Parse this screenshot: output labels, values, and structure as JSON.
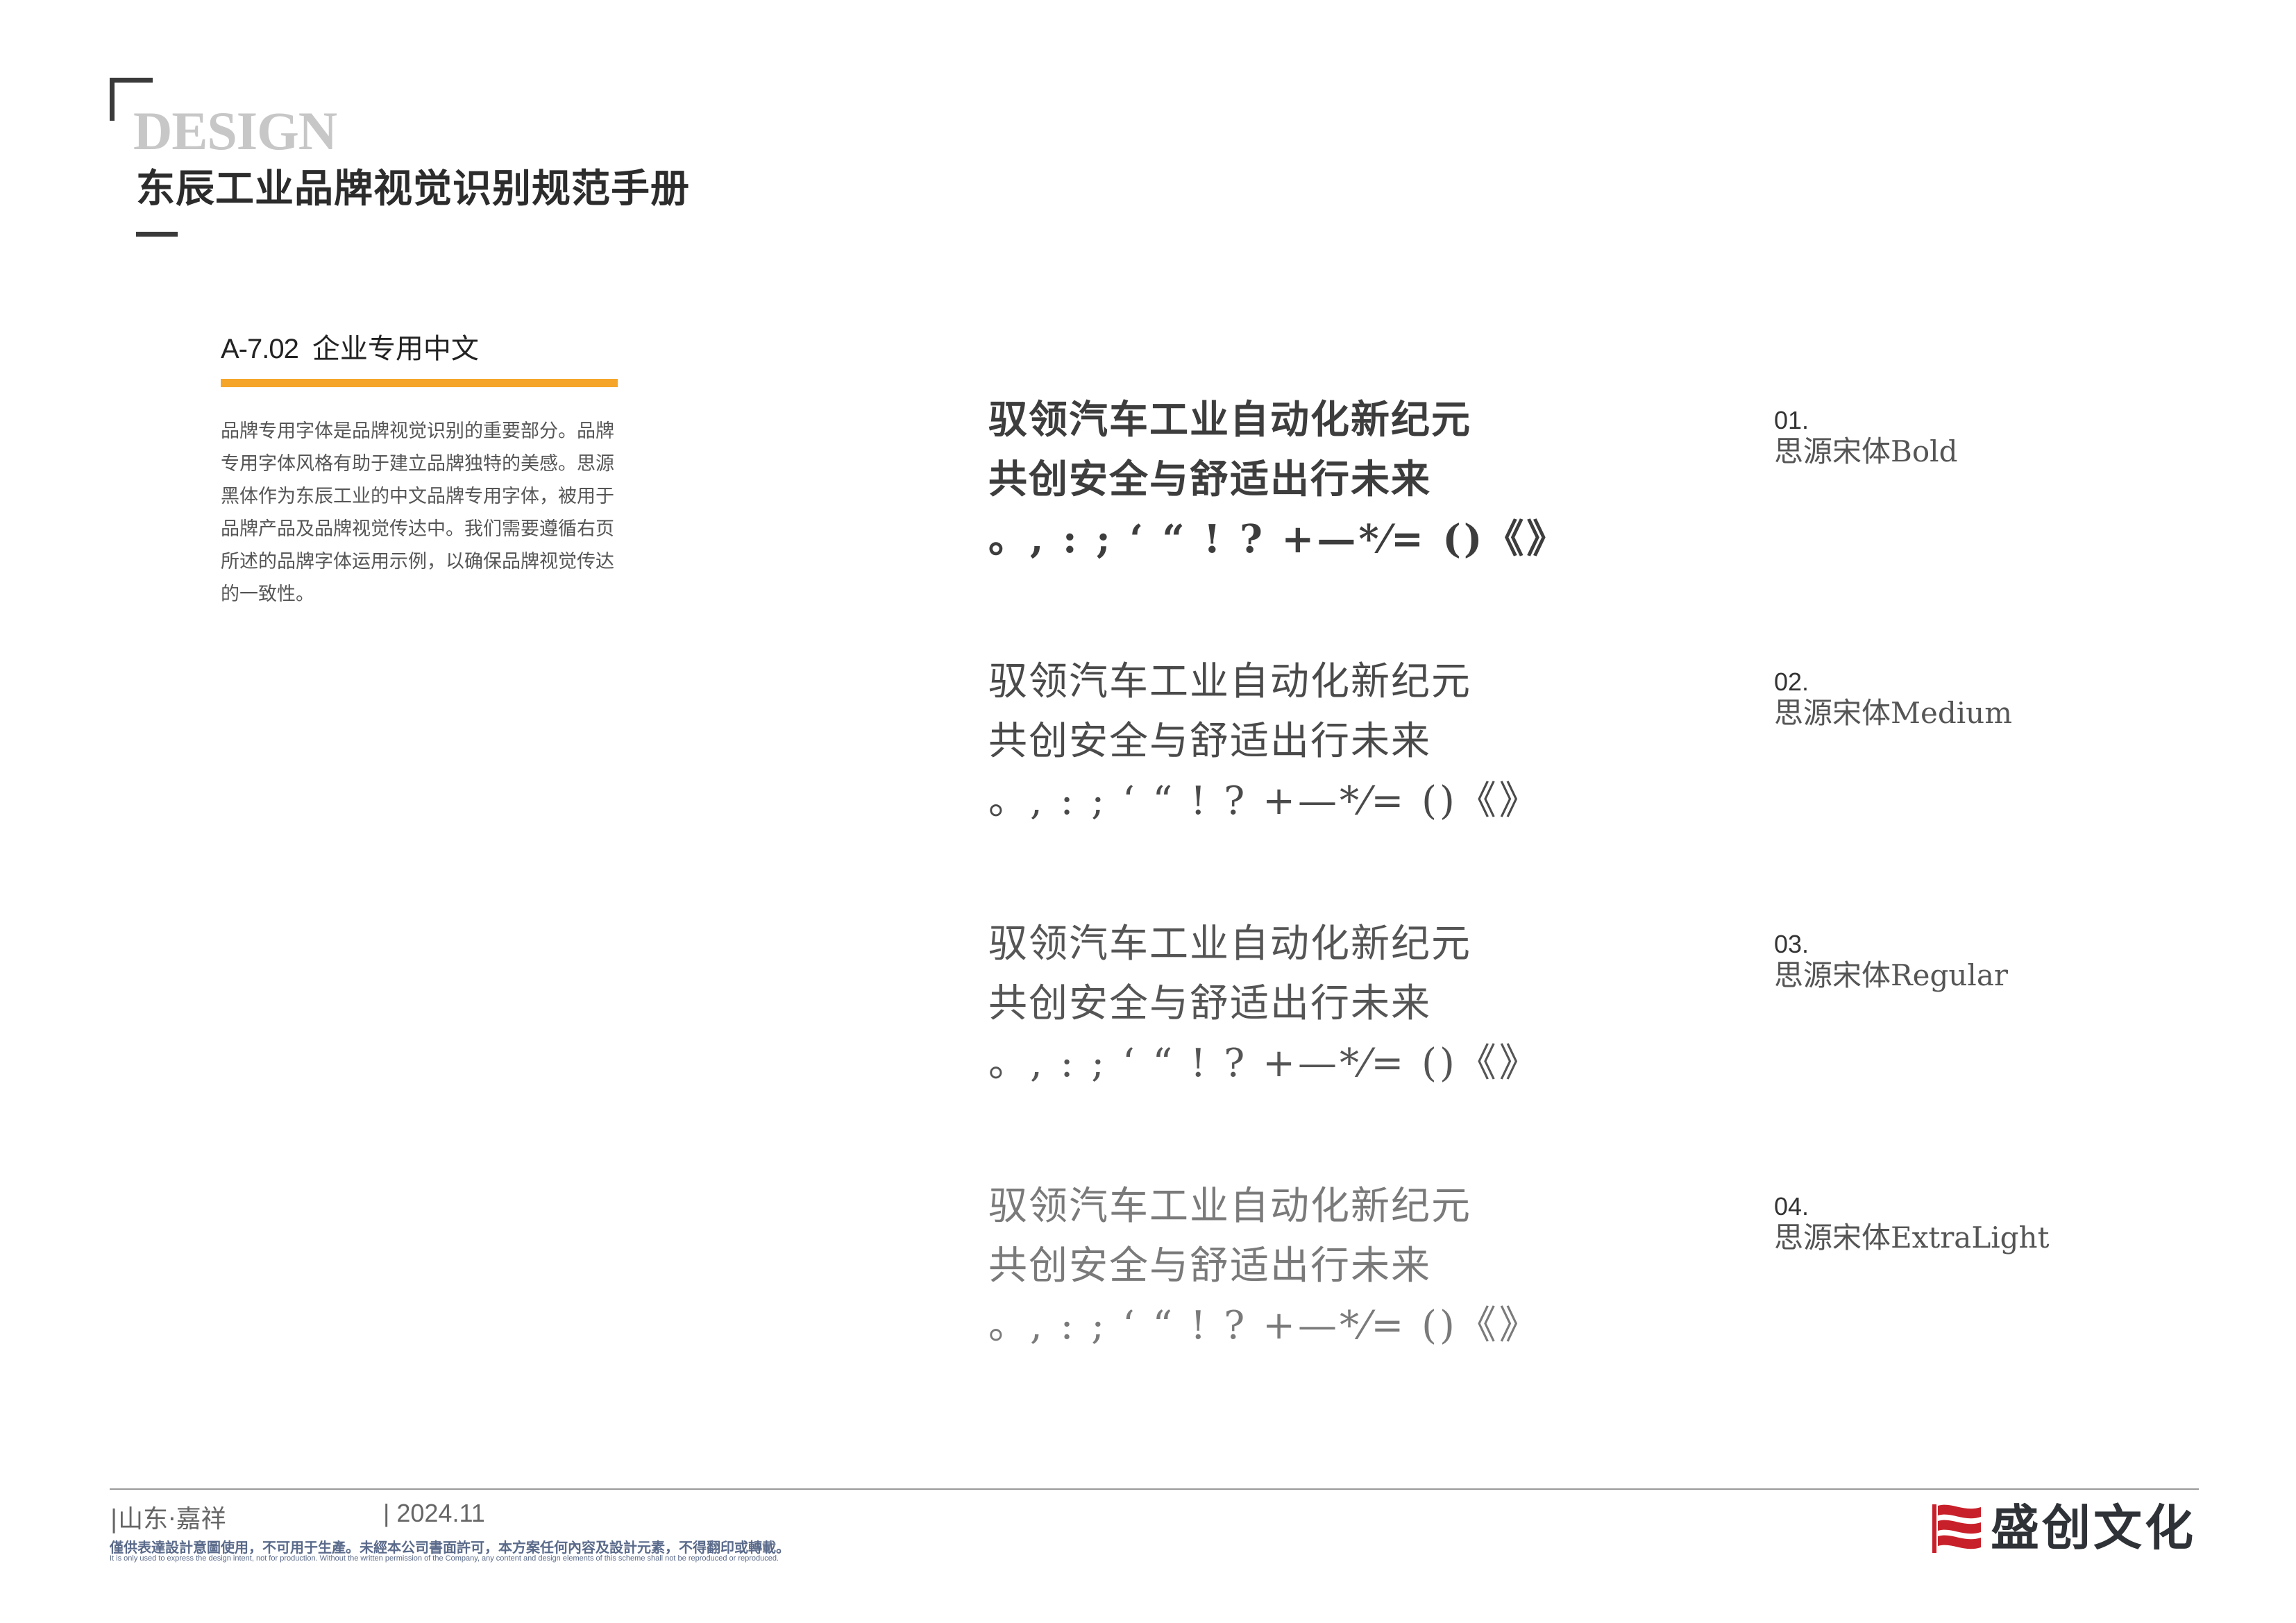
{
  "header": {
    "design_word": "DESIGN",
    "doc_title": "东辰工业品牌视觉识别规范手册"
  },
  "section": {
    "code": "A-7.02",
    "name": "企业专用中文",
    "accent_color": "#f5a62a",
    "description": "品牌专用字体是品牌视觉识别的重要部分。品牌专用字体风格有助于建立品牌独特的美感。思源黑体作为东辰工业的中文品牌专用字体，被用于品牌产品及品牌视觉传达中。我们需要遵循右页所述的品牌字体运用示例，以确保品牌视觉传达的一致性。"
  },
  "specimens": [
    {
      "line1": "驭领汽车工业自动化新纪元",
      "line2": "共创安全与舒适出行未来",
      "punct": "。, : ; ‘ “ ! ? +—*⁄=  ()《》",
      "num": "01.",
      "font_name": "思源宋体Bold"
    },
    {
      "line1": "驭领汽车工业自动化新纪元",
      "line2": "共创安全与舒适出行未来",
      "punct": "。, : ; ‘ “ ! ? +—*⁄=  ()《》",
      "num": "02.",
      "font_name": "思源宋体Medium"
    },
    {
      "line1": "驭领汽车工业自动化新纪元",
      "line2": "共创安全与舒适出行未来",
      "punct": "。, : ; ‘ “ ! ? +—*⁄=  ()《》",
      "num": "03.",
      "font_name": "思源宋体Regular"
    },
    {
      "line1": "驭领汽车工业自动化新纪元",
      "line2": "共创安全与舒适出行未来",
      "punct": "。, : ; ‘ “ ! ? +—*⁄=  ()《》",
      "num": "04.",
      "font_name": "思源宋体ExtraLight"
    }
  ],
  "footer": {
    "location": "|山东·嘉祥",
    "date": "| 2024.11",
    "note_cn": "僅供表達設計意圖使用，不可用于生產。未經本公司書面許可，本方案任何內容及設計元素，不得翻印或轉載。",
    "note_en": "It is only used to express the design intent, not for production. Without the written permission of the Company, any content and design elements of this scheme shall not be reproduced or reproduced.",
    "brand_name": "盛创文化",
    "brand_color": "#c8202a",
    "brand_icon": "flag-logo-icon"
  }
}
